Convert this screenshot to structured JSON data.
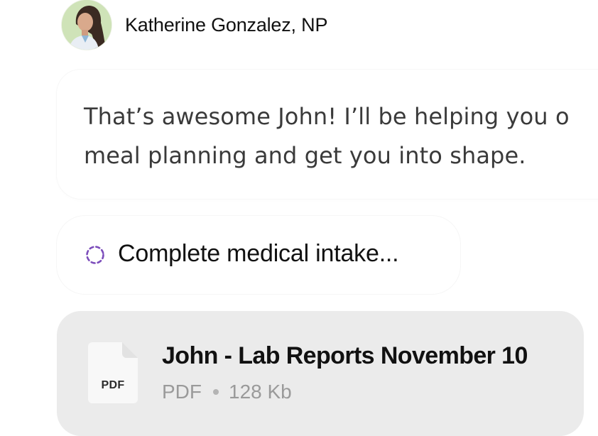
{
  "sender": {
    "name": "Katherine Gonzalez, NP",
    "avatar_icon": "user-avatar-photo"
  },
  "message": {
    "line1": "That’s awesome John! I’ll be helping you o",
    "line2": "meal planning and get you into shape."
  },
  "task": {
    "label": "Complete medical intake...",
    "status_icon": "loading-spinner-icon",
    "accent": "#7c4dbb"
  },
  "attachment": {
    "icon_label": "PDF",
    "file_name": "John - Lab Reports November 10",
    "file_type": "PDF",
    "file_size": "128 Kb",
    "icon": "pdf-file-icon"
  },
  "colors": {
    "card_background": "#ebebeb",
    "text_primary": "#111111",
    "text_muted": "#9a9a9a"
  }
}
